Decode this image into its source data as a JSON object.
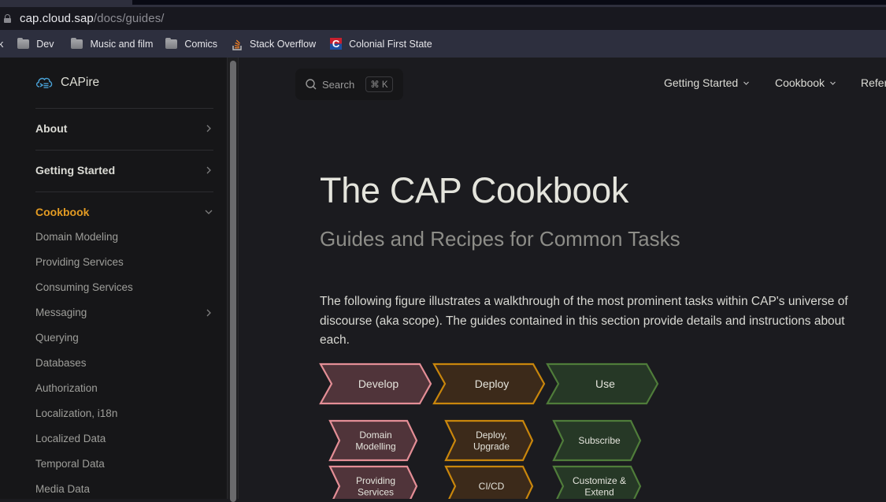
{
  "browser": {
    "url_host": "cap.cloud.sap",
    "url_path": "/docs/guides/",
    "bookmarks": [
      {
        "label": "k",
        "icon": "folder-icon-partial"
      },
      {
        "label": "Dev",
        "icon": "folder-icon"
      },
      {
        "label": "Music and film",
        "icon": "folder-icon"
      },
      {
        "label": "Comics",
        "icon": "folder-icon"
      },
      {
        "label": "Stack Overflow",
        "icon": "stackoverflow-icon"
      },
      {
        "label": "Colonial First State",
        "icon": "cfs-icon"
      }
    ]
  },
  "sidebar": {
    "brand": "CAPire",
    "sections": [
      {
        "label": "About",
        "expanded": false
      },
      {
        "label": "Getting Started",
        "expanded": false
      },
      {
        "label": "Cookbook",
        "expanded": true,
        "active": true
      }
    ],
    "items": [
      {
        "label": "Domain Modeling",
        "has_children": false
      },
      {
        "label": "Providing Services",
        "has_children": false
      },
      {
        "label": "Consuming Services",
        "has_children": false
      },
      {
        "label": "Messaging",
        "has_children": true
      },
      {
        "label": "Querying",
        "has_children": false
      },
      {
        "label": "Databases",
        "has_children": false
      },
      {
        "label": "Authorization",
        "has_children": false
      },
      {
        "label": "Localization, i18n",
        "has_children": false
      },
      {
        "label": "Localized Data",
        "has_children": false
      },
      {
        "label": "Temporal Data",
        "has_children": false
      },
      {
        "label": "Media Data",
        "has_children": false
      }
    ]
  },
  "header": {
    "search_label": "Search",
    "search_shortcut": "⌘ K",
    "nav": [
      {
        "label": "Getting Started",
        "dropdown": true
      },
      {
        "label": "Cookbook",
        "dropdown": true
      },
      {
        "label": "Refer",
        "dropdown": false
      }
    ]
  },
  "content": {
    "title": "The CAP Cookbook",
    "subtitle": "Guides and Recipes for Common Tasks",
    "intro": "The following figure illustrates a walkthrough of the most prominent tasks within CAP's universe of discourse (aka scope). The guides contained in this section provide details and instructions about each."
  },
  "figure": {
    "colors": {
      "develop_fill": "#50343a",
      "develop_stroke": "#e48e96",
      "deploy_fill": "#3c2a1a",
      "deploy_stroke": "#c9860c",
      "use_fill": "#263826",
      "use_stroke": "#4f7c3a"
    },
    "columns": [
      {
        "key": "develop",
        "header": "Develop",
        "steps": [
          [
            "Domain",
            "Modelling"
          ],
          [
            "Providing",
            "Services"
          ]
        ]
      },
      {
        "key": "deploy",
        "header": "Deploy",
        "steps": [
          [
            "Deploy,",
            "Upgrade"
          ],
          [
            "CI/CD"
          ]
        ]
      },
      {
        "key": "use",
        "header": "Use",
        "steps": [
          [
            "Subscribe"
          ],
          [
            "Customize &",
            "Extend"
          ]
        ]
      }
    ]
  }
}
